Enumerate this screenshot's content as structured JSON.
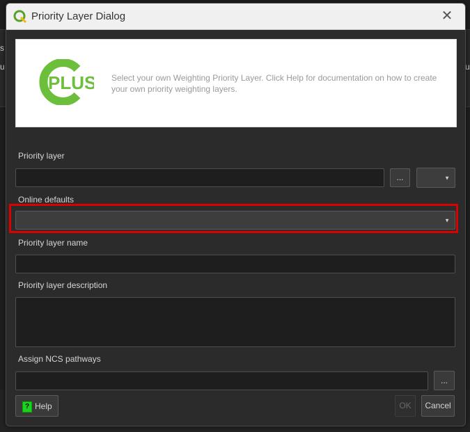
{
  "window": {
    "title": "Priority Layer Dialog",
    "close_icon": "close-icon"
  },
  "banner": {
    "logo_text": "PLUS",
    "description": "Select your own Weighting Priority Layer. Click Help for documentation on how to create your own priority weighting layers."
  },
  "fields": {
    "priority_layer": {
      "label": "Priority layer",
      "value": "",
      "browse_label": "..."
    },
    "online_defaults": {
      "label": "Online defaults",
      "value": ""
    },
    "priority_layer_name": {
      "label": "Priority layer name",
      "value": ""
    },
    "priority_layer_description": {
      "label": "Priority layer description",
      "value": ""
    },
    "assign_ncs_pathways": {
      "label": "Assign NCS pathways",
      "value": "",
      "browse_label": "..."
    }
  },
  "buttons": {
    "help": "Help",
    "ok": "OK",
    "cancel": "Cancel"
  },
  "background": {
    "left_letter_1": "s",
    "left_letter_2": "u",
    "right_text": "up"
  },
  "colors": {
    "highlight": "#dd0000",
    "logo_green": "#6bbf3a",
    "help_icon": "#1ed11e"
  }
}
